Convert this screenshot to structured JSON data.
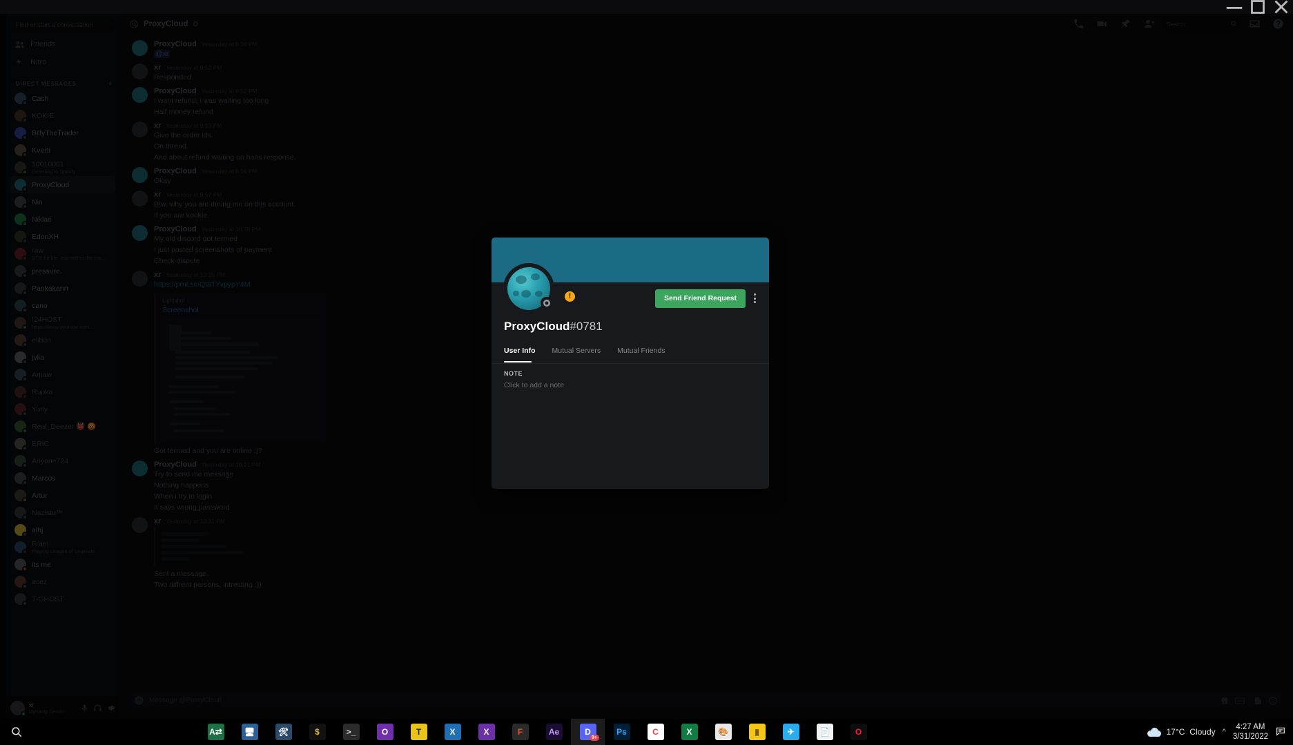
{
  "window": {
    "minimize": "—",
    "maximize": "▢",
    "close": "✕"
  },
  "sidebar": {
    "search_placeholder": "Find or start a conversation",
    "nav": [
      {
        "label": "Friends",
        "icon": "friends-icon"
      },
      {
        "label": "Nitro",
        "icon": "nitro-icon"
      }
    ],
    "dm_header": "DIRECT MESSAGES",
    "add_dm": "+",
    "dms": [
      {
        "name": "Cash",
        "status": "offline",
        "sub": "",
        "bright": true,
        "active": false,
        "avatar": "#3a4b63"
      },
      {
        "name": "KOKIE",
        "status": "offline",
        "sub": "",
        "bright": false,
        "active": false,
        "avatar": "#4a3526"
      },
      {
        "name": "BillyTheTrader",
        "status": "offline",
        "sub": "",
        "bright": true,
        "active": false,
        "avatar": "#3b46a8"
      },
      {
        "name": "Kverti",
        "status": "offline",
        "sub": "",
        "bright": true,
        "active": false,
        "avatar": "#5b5047"
      },
      {
        "name": "10010001",
        "status": "online",
        "sub": "Listening to Spotify",
        "bright": false,
        "active": false,
        "avatar": "#3c3a33"
      },
      {
        "name": "ProxyCloud",
        "status": "offline",
        "sub": "",
        "bright": true,
        "active": true,
        "avatar": "#1f6f7e"
      },
      {
        "name": "Nin",
        "status": "offline",
        "sub": "",
        "bright": true,
        "active": false,
        "avatar": "#4a4a4a"
      },
      {
        "name": "Niklas",
        "status": "online",
        "sub": "",
        "bright": true,
        "active": false,
        "avatar": "#1f7a4a"
      },
      {
        "name": "EdonXH",
        "status": "offline",
        "sub": "",
        "bright": true,
        "active": false,
        "avatar": "#2d3a2a"
      },
      {
        "name": "raw",
        "status": "dnd",
        "sub": "DTB for life, married to the mo…",
        "bright": false,
        "active": false,
        "avatar": "#6b2326"
      },
      {
        "name": "pressure.",
        "status": "offline",
        "sub": "",
        "bright": true,
        "active": false,
        "avatar": "#3a3f4a"
      },
      {
        "name": "Pankakann",
        "status": "offline",
        "sub": "",
        "bright": true,
        "active": false,
        "avatar": "#3b3b3b"
      },
      {
        "name": "cano",
        "status": "offline",
        "sub": "",
        "bright": true,
        "active": false,
        "avatar": "#2f4b55"
      },
      {
        "name": "!24HOST",
        "status": "online",
        "sub": "https://www.youtube.com…",
        "bright": false,
        "active": false,
        "avatar": "#4b3a33"
      },
      {
        "name": "elibon",
        "status": "offline",
        "sub": "",
        "bright": false,
        "active": false,
        "avatar": "#5a4233"
      },
      {
        "name": "jvlia",
        "status": "offline",
        "sub": "",
        "bright": true,
        "active": false,
        "avatar": "#6a6a6a"
      },
      {
        "name": "Amaw",
        "status": "offline",
        "sub": "",
        "bright": false,
        "active": false,
        "avatar": "#3c4a5a"
      },
      {
        "name": "Ruoka",
        "status": "dnd",
        "sub": "",
        "bright": false,
        "active": false,
        "avatar": "#4a2b2b"
      },
      {
        "name": "Yuriy",
        "status": "offline",
        "sub": "",
        "bright": false,
        "active": false,
        "avatar": "#5a2a2a"
      },
      {
        "name": "Real_Deezer 👹 😡",
        "status": "online",
        "sub": "",
        "bright": false,
        "active": false,
        "avatar": "#3e5a33"
      },
      {
        "name": "ERIC",
        "status": "offline",
        "sub": "",
        "bright": false,
        "active": false,
        "avatar": "#5e5a52"
      },
      {
        "name": "Anyone724",
        "status": "offline",
        "sub": "",
        "bright": false,
        "active": false,
        "avatar": "#3a4a3a"
      },
      {
        "name": "Marcos",
        "status": "offline",
        "sub": "",
        "bright": true,
        "active": false,
        "avatar": "#4a4a4a"
      },
      {
        "name": "Artur",
        "status": "idle",
        "sub": "",
        "bright": true,
        "active": false,
        "avatar": "#4a4236"
      },
      {
        "name": "Nazistu™",
        "status": "offline",
        "sub": "",
        "bright": false,
        "active": false,
        "avatar": "#3a3a3a"
      },
      {
        "name": "alhj",
        "status": "offline",
        "sub": "",
        "bright": true,
        "active": false,
        "avatar": "#d8b33a"
      },
      {
        "name": "Fram",
        "status": "dnd",
        "sub": "Playing League of Legends",
        "bright": false,
        "active": false,
        "avatar": "#2a4a6a"
      },
      {
        "name": "its me",
        "status": "idle",
        "sub": "",
        "bright": true,
        "active": false,
        "avatar": "#5a5a66"
      },
      {
        "name": "acez",
        "status": "offline",
        "sub": "",
        "bright": false,
        "active": false,
        "avatar": "#5a3a33"
      },
      {
        "name": "T-GHOST",
        "status": "offline",
        "sub": "",
        "bright": false,
        "active": false,
        "avatar": "#3a3a42"
      }
    ],
    "user": {
      "name": "xr",
      "sub": "Dynasty Servic…",
      "mic": "microphone-icon",
      "headset": "headset-icon",
      "settings": "gear-icon"
    }
  },
  "channel": {
    "name": "ProxyCloud",
    "at": "@",
    "icons": [
      "call-icon",
      "video-icon",
      "pin-icon",
      "add-friend-icon",
      "inbox-icon",
      "help-icon"
    ],
    "search_placeholder": "Search"
  },
  "messages": [
    {
      "author": "ProxyCloud",
      "ts": "Yesterday at 9:50 PM",
      "avatar": "#1f6f7e",
      "lines": [
        {
          "text": "@xr",
          "type": "mention"
        }
      ]
    },
    {
      "author": "xr",
      "ts": "Yesterday at 9:52 PM",
      "avatar": "#2b2d33",
      "lines": [
        {
          "text": "Responded.",
          "type": "text"
        }
      ]
    },
    {
      "author": "ProxyCloud",
      "ts": "Yesterday at 9:52 PM",
      "avatar": "#1f6f7e",
      "lines": [
        {
          "text": "I want refund, i was waiting too long",
          "type": "text"
        },
        {
          "text": "Half money refund",
          "type": "text"
        }
      ]
    },
    {
      "author": "xr",
      "ts": "Yesterday at 9:53 PM",
      "avatar": "#2b2d33",
      "lines": [
        {
          "text": "Give the order ids.",
          "type": "text"
        },
        {
          "text": "On thread.",
          "type": "text"
        },
        {
          "text": "And about refund waiting on hans response.",
          "type": "text"
        }
      ]
    },
    {
      "author": "ProxyCloud",
      "ts": "Yesterday at 9:56 PM",
      "avatar": "#1f6f7e",
      "lines": [
        {
          "text": "Okay",
          "type": "text"
        }
      ]
    },
    {
      "author": "xr",
      "ts": "Yesterday at 9:57 PM",
      "avatar": "#2b2d33",
      "lines": [
        {
          "text": "Btw, why you are dming me on this account.",
          "type": "text"
        },
        {
          "text": "If you are kookie.",
          "type": "text"
        }
      ]
    },
    {
      "author": "ProxyCloud",
      "ts": "Yesterday at 10:20 PM",
      "avatar": "#1f6f7e",
      "lines": [
        {
          "text": "My old discord got termed",
          "type": "text"
        },
        {
          "text": "I just posted screenshots of payment",
          "type": "text"
        },
        {
          "text": "Check dispute",
          "type": "text"
        }
      ]
    },
    {
      "author": "xr",
      "ts": "Yesterday at 10:20 PM",
      "avatar": "#2b2d33",
      "lines": [
        {
          "text": "https://prnt.sc/Qt8TYvpypY4M",
          "type": "link"
        }
      ],
      "embed": {
        "provider": "Lightshot",
        "title": "Screenshot"
      },
      "after": [
        {
          "text": "Got termed and you are online :)?",
          "type": "text"
        }
      ]
    },
    {
      "author": "ProxyCloud",
      "ts": "Yesterday at 10:21 PM",
      "avatar": "#1f6f7e",
      "lines": [
        {
          "text": "Try to send me message",
          "type": "text"
        },
        {
          "text": "Nothing happens",
          "type": "text"
        },
        {
          "text": "When i try to login",
          "type": "text"
        },
        {
          "text": "It says wrong password",
          "type": "text"
        }
      ]
    },
    {
      "author": "xr",
      "ts": "Yesterday at 10:21 PM",
      "avatar": "#2b2d33",
      "lines": [],
      "quote": true,
      "after": [
        {
          "text": "Sent a message.",
          "type": "text"
        },
        {
          "text": "Two diffrent persons, intresting :))",
          "type": "text"
        }
      ]
    }
  ],
  "composer": {
    "placeholder": "Message @ProxyCloud",
    "plus": "+",
    "icons": [
      "gift-icon",
      "gif-icon",
      "sticker-icon",
      "emoji-icon"
    ],
    "gif_label": "GIF"
  },
  "profile_modal": {
    "username": "ProxyCloud",
    "discriminator": "#0781",
    "banner_color": "#1b6b84",
    "accent_button": "#3ba55d",
    "send_friend_request": "Send Friend Request",
    "more_options": "more-options-icon",
    "warning_badge": "!",
    "tabs": [
      {
        "label": "User Info",
        "selected": true
      },
      {
        "label": "Mutual Servers",
        "selected": false
      },
      {
        "label": "Mutual Friends",
        "selected": false
      }
    ],
    "note_label": "NOTE",
    "note_placeholder": "Click to add a note"
  },
  "taskbar": {
    "start": "windows-start-icon",
    "search": "search-icon",
    "apps": [
      {
        "name": "excel-green-app",
        "glyph": "A⇄",
        "bg": "#1d7044",
        "fg": "#ffffff"
      },
      {
        "name": "monitor-app",
        "glyph": "🖥",
        "bg": "#2b5f96",
        "fg": "#ffffff"
      },
      {
        "name": "tool-app",
        "glyph": "🛠",
        "bg": "#2a4a6a",
        "fg": "#ffffff"
      },
      {
        "name": "dollar-app",
        "glyph": "$",
        "bg": "#111111",
        "fg": "#e8b417"
      },
      {
        "name": "terminal-app",
        "glyph": ">_",
        "bg": "#2b2b2b",
        "fg": "#d8d8d8"
      },
      {
        "name": "opera-gx-app",
        "glyph": "O",
        "bg": "#6f2fa8",
        "fg": "#ffffff"
      },
      {
        "name": "tor-browser-app",
        "glyph": "T",
        "bg": "#e8c31a",
        "fg": "#2a2a2a"
      },
      {
        "name": "vscode-app",
        "glyph": "X",
        "bg": "#1f6fb2",
        "fg": "#ffffff"
      },
      {
        "name": "vscode-insiders-app",
        "glyph": "X",
        "bg": "#6b2fa8",
        "fg": "#ffffff"
      },
      {
        "name": "figma-app",
        "glyph": "F",
        "bg": "#2a2a2a",
        "fg": "#f24e1e"
      },
      {
        "name": "after-effects-app",
        "glyph": "Ae",
        "bg": "#1a0d33",
        "fg": "#cf96fd"
      },
      {
        "name": "discord-app",
        "glyph": "D",
        "bg": "#5865f2",
        "fg": "#ffffff",
        "badge": "9+",
        "active": true
      },
      {
        "name": "photoshop-app",
        "glyph": "Ps",
        "bg": "#001e36",
        "fg": "#31a8ff"
      },
      {
        "name": "chrome-app",
        "glyph": "C",
        "bg": "#ffffff",
        "fg": "#ea4335"
      },
      {
        "name": "excel-app",
        "glyph": "X",
        "bg": "#107c41",
        "fg": "#ffffff"
      },
      {
        "name": "paint-app",
        "glyph": "🎨",
        "bg": "#e8e8e8",
        "fg": "#cc3333"
      },
      {
        "name": "sticky-notes-app",
        "glyph": "▮",
        "bg": "#f5c518",
        "fg": "#7a5c00"
      },
      {
        "name": "telegram-app",
        "glyph": "✈",
        "bg": "#2aabee",
        "fg": "#ffffff"
      },
      {
        "name": "notepad-app",
        "glyph": "📄",
        "bg": "#f2f2f2",
        "fg": "#6b6b6b"
      },
      {
        "name": "opera-app",
        "glyph": "O",
        "bg": "#0d0d0d",
        "fg": "#ff1b2d"
      }
    ],
    "tray": {
      "temperature": "17°C",
      "condition": "Cloudy",
      "chevron": "^",
      "time": "4:27 AM",
      "date": "3/31/2022",
      "notification": "notification-icon"
    }
  }
}
